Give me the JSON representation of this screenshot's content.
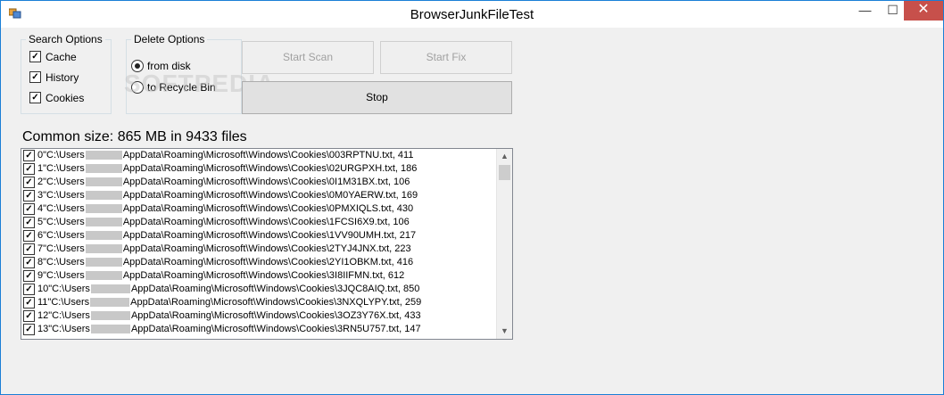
{
  "window": {
    "title": "BrowserJunkFileTest"
  },
  "controls": {
    "minimize": "—",
    "maximize": "☐",
    "close": "✕"
  },
  "search_options": {
    "label": "Search Options",
    "items": [
      {
        "label": "Cache",
        "checked": true
      },
      {
        "label": "History",
        "checked": true
      },
      {
        "label": "Cookies",
        "checked": true
      }
    ]
  },
  "delete_options": {
    "label": "Delete Options",
    "items": [
      {
        "label": "from disk",
        "selected": true
      },
      {
        "label": "to Recycle Bin",
        "selected": false
      }
    ]
  },
  "buttons": {
    "start_scan": "Start Scan",
    "start_fix": "Start Fix",
    "stop": "Stop"
  },
  "summary": "Common size: 865 MB in 9433 files",
  "watermark": "SOFTPEDIA",
  "list": {
    "rows": [
      {
        "index": "0",
        "prefix": "\"C:\\Users",
        "path": "AppData\\Roaming\\Microsoft\\Windows\\Cookies\\003RPTNU.txt, 411",
        "checked": true
      },
      {
        "index": "1",
        "prefix": "\"C:\\Users",
        "path": "AppData\\Roaming\\Microsoft\\Windows\\Cookies\\02URGPXH.txt, 186",
        "checked": true
      },
      {
        "index": "2",
        "prefix": "\"C:\\Users",
        "path": "AppData\\Roaming\\Microsoft\\Windows\\Cookies\\0I1M31BX.txt, 106",
        "checked": true
      },
      {
        "index": "3",
        "prefix": "\"C:\\Users",
        "path": "AppData\\Roaming\\Microsoft\\Windows\\Cookies\\0M0YAERW.txt, 169",
        "checked": true
      },
      {
        "index": "4",
        "prefix": "\"C:\\Users",
        "path": "AppData\\Roaming\\Microsoft\\Windows\\Cookies\\0PMXIQLS.txt, 430",
        "checked": true
      },
      {
        "index": "5",
        "prefix": "\"C:\\Users",
        "path": "AppData\\Roaming\\Microsoft\\Windows\\Cookies\\1FCSI6X9.txt, 106",
        "checked": true
      },
      {
        "index": "6",
        "prefix": "\"C:\\Users",
        "path": "AppData\\Roaming\\Microsoft\\Windows\\Cookies\\1VV90UMH.txt, 217",
        "checked": true
      },
      {
        "index": "7",
        "prefix": "\"C:\\Users",
        "path": "AppData\\Roaming\\Microsoft\\Windows\\Cookies\\2TYJ4JNX.txt, 223",
        "checked": true
      },
      {
        "index": "8",
        "prefix": "\"C:\\Users",
        "path": "AppData\\Roaming\\Microsoft\\Windows\\Cookies\\2YI1OBKM.txt, 416",
        "checked": true
      },
      {
        "index": "9",
        "prefix": "\"C:\\Users",
        "path": "AppData\\Roaming\\Microsoft\\Windows\\Cookies\\3I8IIFMN.txt, 612",
        "checked": true
      },
      {
        "index": "10",
        "prefix": "\"C:\\Users",
        "path": "AppData\\Roaming\\Microsoft\\Windows\\Cookies\\3JQC8AIQ.txt, 850",
        "checked": true
      },
      {
        "index": "11",
        "prefix": "\"C:\\Users",
        "path": "AppData\\Roaming\\Microsoft\\Windows\\Cookies\\3NXQLYPY.txt, 259",
        "checked": true
      },
      {
        "index": "12",
        "prefix": "\"C:\\Users",
        "path": "AppData\\Roaming\\Microsoft\\Windows\\Cookies\\3OZ3Y76X.txt, 433",
        "checked": true
      },
      {
        "index": "13",
        "prefix": "\"C:\\Users",
        "path": "AppData\\Roaming\\Microsoft\\Windows\\Cookies\\3RN5U757.txt, 147",
        "checked": true
      }
    ]
  },
  "colors": {
    "title_bar": "#ffffff",
    "window_bg": "#f0f0f0",
    "close_button": "#c7504b",
    "window_border": "#1a7fd6"
  }
}
